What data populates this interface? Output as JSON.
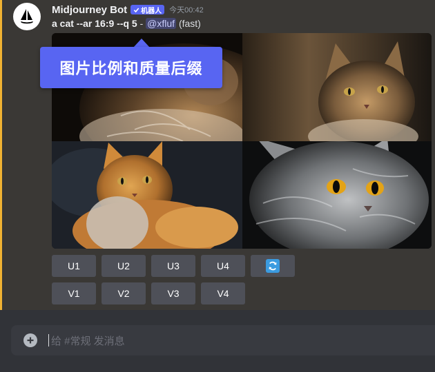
{
  "message": {
    "author": "Midjourney Bot",
    "bot_tag": "机器人",
    "timestamp": "今天00:42",
    "prompt": "a cat --ar 16:9 --q 5",
    "separator": " - ",
    "mention": "@xfluf",
    "speed": " (fast)"
  },
  "callout": {
    "text": "图片比例和质量后缀"
  },
  "upscale_buttons": [
    "U1",
    "U2",
    "U3",
    "U4"
  ],
  "variation_buttons": [
    "V1",
    "V2",
    "V3",
    "V4"
  ],
  "icons": {
    "avatar": "sailboat-logo-icon",
    "bot_check": "check-icon",
    "reroll": "refresh-icon",
    "add": "plus-circle-icon"
  },
  "composer": {
    "placeholder": "给 #常规 发消息"
  },
  "colors": {
    "accent": "#5865f2",
    "highlight_bar": "#f0b232",
    "button": "#4e5058",
    "reroll_icon": "#3b9be0"
  }
}
